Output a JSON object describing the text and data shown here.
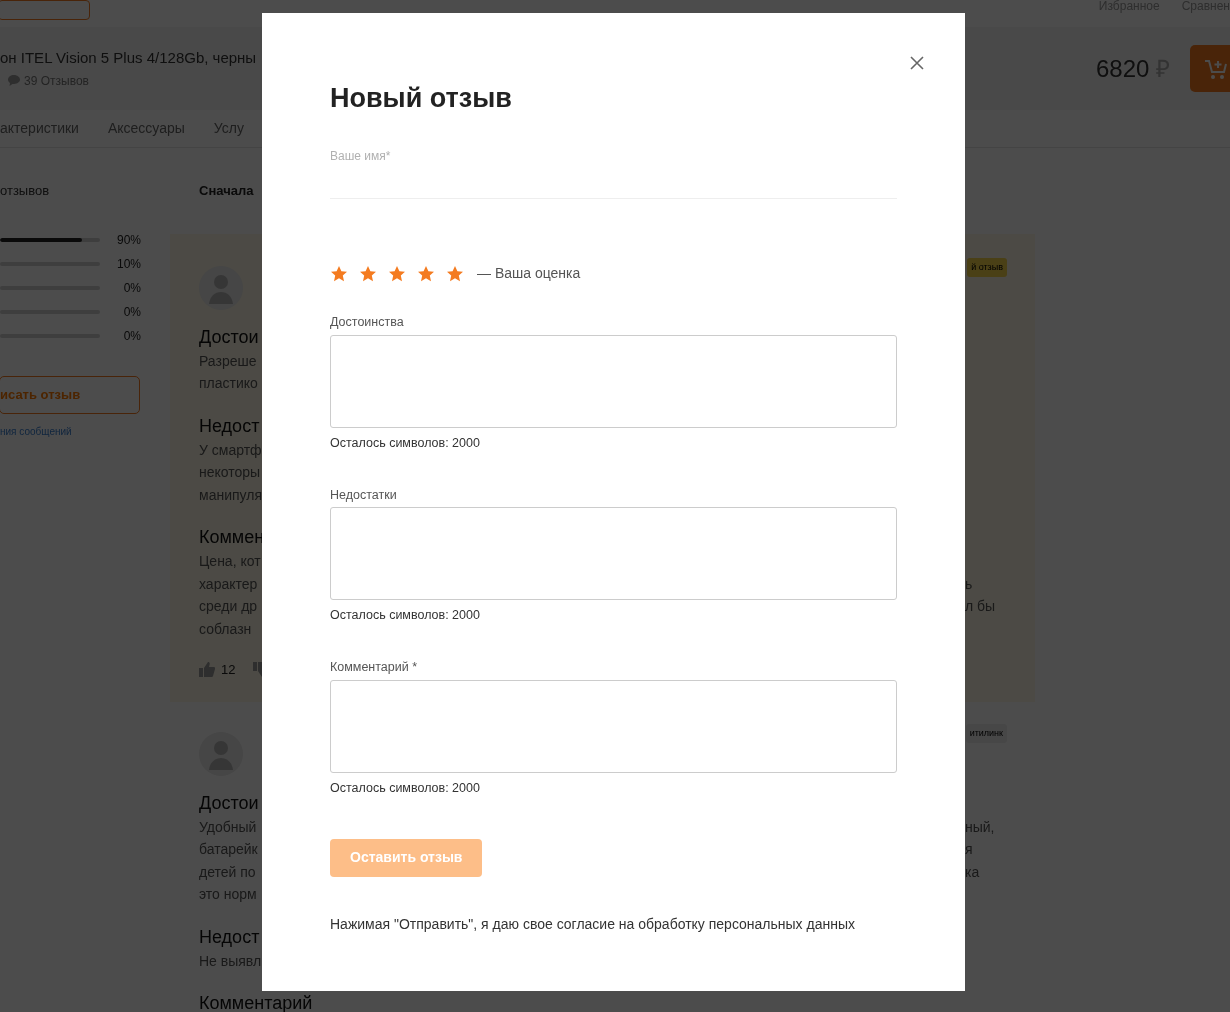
{
  "page": {
    "header": {
      "links": [
        "Избранное",
        "Сравнен"
      ]
    },
    "product": {
      "title": "он ITEL Vision 5 Plus 4/128Gb, черны",
      "reviews_count": "39 Отзывов",
      "price": "6820",
      "currency": "₽"
    },
    "tabs": [
      {
        "label": "актеристики"
      },
      {
        "label": "Аксессуары"
      },
      {
        "label": "Услу"
      }
    ],
    "summary": {
      "title": "отзывов",
      "bars": [
        {
          "level": 0.82,
          "reading": "90%"
        },
        {
          "level": 0.0,
          "reading": "10%"
        },
        {
          "level": 0.0,
          "reading": "0%"
        },
        {
          "level": 0.0,
          "reading": "0%"
        },
        {
          "level": 0.0,
          "reading": "0%"
        }
      ],
      "write_button": "исать отзыв",
      "rules_link": "ния сообщений"
    },
    "sort_label": "Сначала",
    "reviews": [
      {
        "highlighted": true,
        "badge": "й отзыв",
        "sections": [
          {
            "title": "Достои",
            "lines": [
              {
                "text": "Разреше"
              },
              {
                "text": "пластико"
              }
            ]
          },
          {
            "title": "Недост",
            "lines": [
              {
                "text": "У смартф"
              },
              {
                "text": "некоторы"
              },
              {
                "text": "манипуля"
              }
            ]
          },
          {
            "title": "Коммен",
            "lines": [
              {
                "text": "Цена, кот"
              },
              {
                "text": "характер",
                "tail": "ь"
              },
              {
                "text": "среди др",
                "tail": "л бы"
              },
              {
                "text": "соблазн"
              }
            ]
          }
        ],
        "likes": "12"
      },
      {
        "highlighted": false,
        "badge": "итилинк",
        "sections": [
          {
            "title": "Достои",
            "lines": [
              {
                "text": "Удобный",
                "tail": "ный,"
              },
              {
                "text": "батарейк",
                "tail": "я"
              },
              {
                "text": "детей по",
                "tail": "ка"
              },
              {
                "text": "это норм"
              }
            ]
          },
          {
            "title": "Недост",
            "lines": [
              {
                "text": "Не выявл"
              }
            ]
          },
          {
            "title": "Комментарий"
          }
        ]
      }
    ]
  },
  "modal": {
    "title": "Новый отзыв",
    "name_field": {
      "label": "Ваше имя*"
    },
    "rating": {
      "stars": 5,
      "caption": "— Ваша оценка"
    },
    "fields": [
      {
        "label": "Достоинства",
        "counter": "Осталось символов: 2000"
      },
      {
        "label": "Недостатки",
        "counter": "Осталось символов: 2000"
      },
      {
        "label": "Комментарий *",
        "counter": "Осталось символов: 2000"
      }
    ],
    "submit": {
      "label": "Оставить отзыв",
      "disabled": true
    },
    "consent": {
      "text": "Нажимая \"Отправить\", я даю свое согласие на",
      "link": "обработку персональных данных"
    }
  }
}
